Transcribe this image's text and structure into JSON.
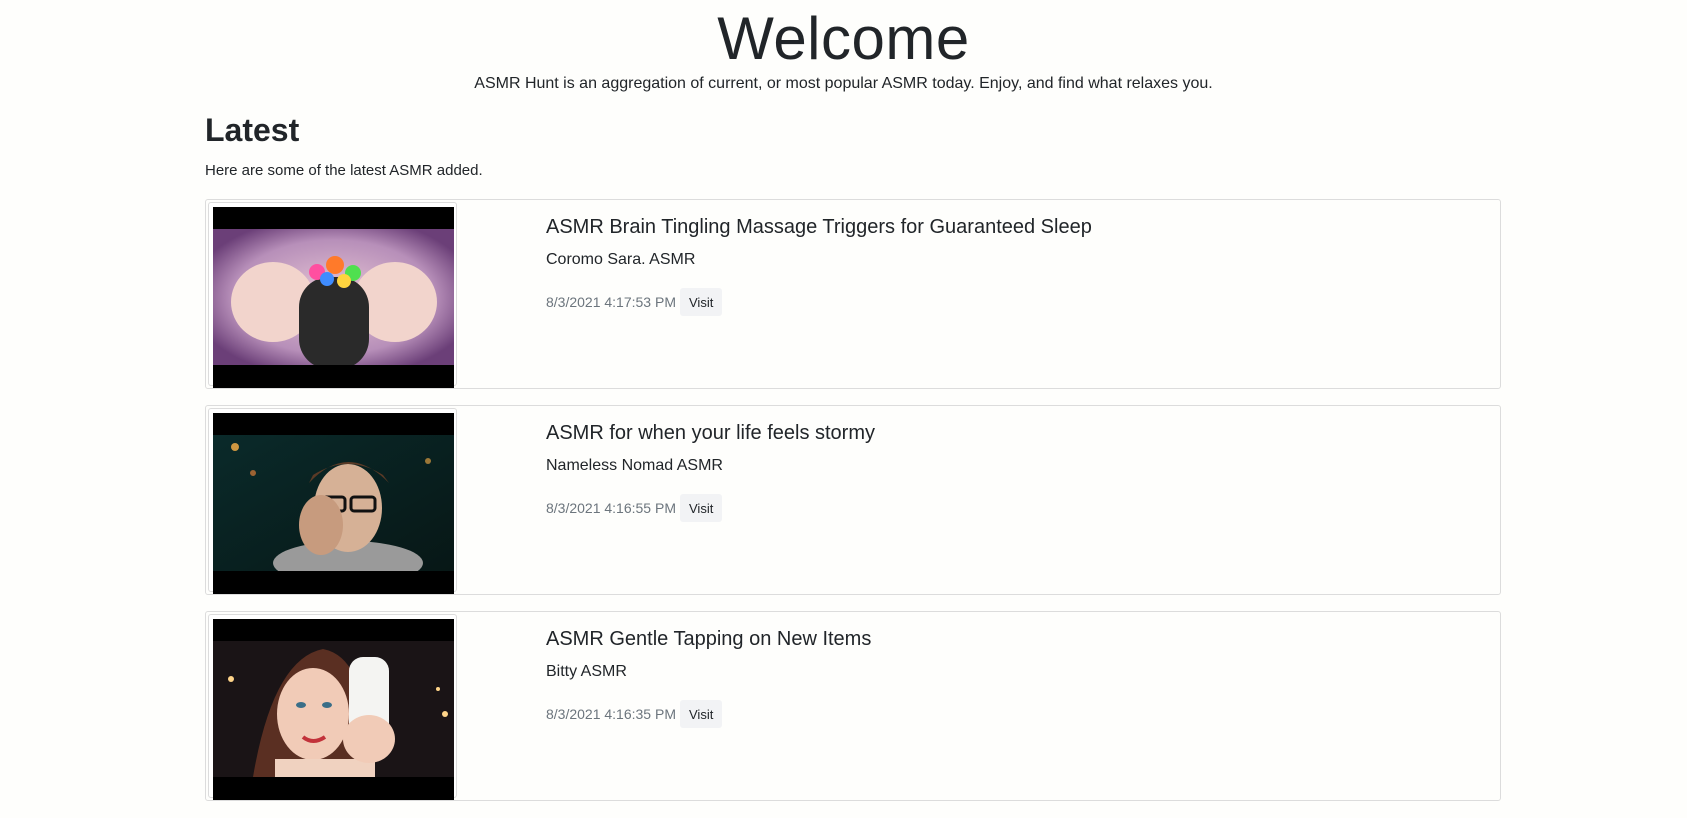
{
  "hero": {
    "title": "Welcome",
    "subtitle": "ASMR Hunt is an aggregation of current, or most popular ASMR today. Enjoy, and find what relaxes you."
  },
  "latest": {
    "heading": "Latest",
    "description": "Here are some of the latest ASMR added.",
    "items": [
      {
        "title": "ASMR Brain Tingling Massage Triggers for Guaranteed Sleep",
        "channel": "Coromo Sara. ASMR",
        "date": "8/3/2021 4:17:53 PM",
        "visit_label": "Visit"
      },
      {
        "title": "ASMR for when your life feels stormy",
        "channel": "Nameless Nomad ASMR",
        "date": "8/3/2021 4:16:55 PM",
        "visit_label": "Visit"
      },
      {
        "title": "ASMR Gentle Tapping on New Items",
        "channel": "Bitty ASMR",
        "date": "8/3/2021 4:16:35 PM",
        "visit_label": "Visit"
      }
    ]
  }
}
